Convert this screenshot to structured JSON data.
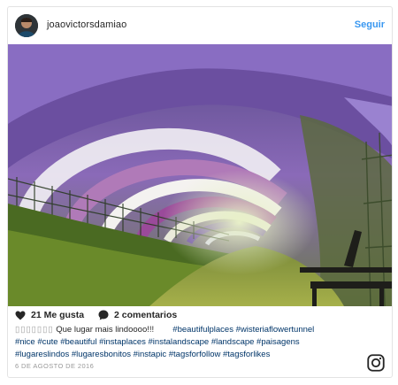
{
  "post": {
    "username": "joaovictorsdamiao",
    "follow_label": "Seguir",
    "likes_label": "21 Me gusta",
    "comments_label": "2 comentarios",
    "caption_prefix": "▯▯▯▯▯▯▯",
    "caption_text": "Que lugar mais lindoooo!!!",
    "hashtags_line1": "#beautifulplaces #wisteriaflowertunnel",
    "hashtags_line2": "#nice #cute #beautiful #instaplaces #instalandscape #landscape #paisagens",
    "hashtags_line3": "#lugareslindos #lugaresbonitos #instapic #tagsforfollow #tagsforlikes",
    "date": "6 DE AGOSTO DE 2016"
  },
  "icons": {
    "like": "heart-icon",
    "comment": "comment-bubble-icon",
    "instagram": "instagram-logo-icon"
  },
  "colors": {
    "link": "#3897f0",
    "hashtag": "#003569",
    "muted": "#999999"
  }
}
